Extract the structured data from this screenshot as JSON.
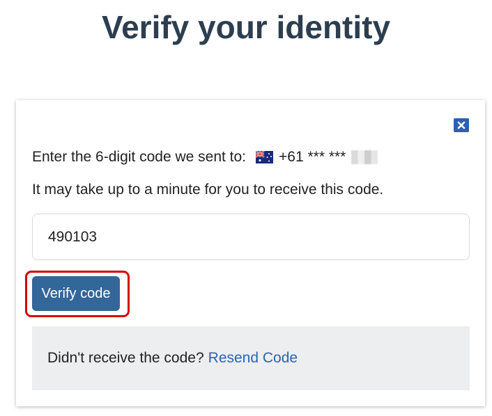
{
  "page": {
    "title": "Verify your identity"
  },
  "dialog": {
    "close_icon": "close-icon",
    "sent_prefix": "Enter the 6-digit code we sent to:",
    "country_flag_icon": "australia-flag-icon",
    "phone_visible": "+61 *** ***",
    "wait_notice": "It may take up to a minute for you to receive this code.",
    "code_input": {
      "value": "490103",
      "placeholder": ""
    },
    "verify_button_label": "Verify code",
    "resend": {
      "prompt": "Didn't receive the code?",
      "link_label": "Resend Code"
    }
  },
  "colors": {
    "title": "#2c3e50",
    "verify_button": "#336699",
    "close_button": "#2e5fb3",
    "link": "#2a63b6",
    "highlight": "#d60000",
    "resend_panel": "#eceeef"
  }
}
